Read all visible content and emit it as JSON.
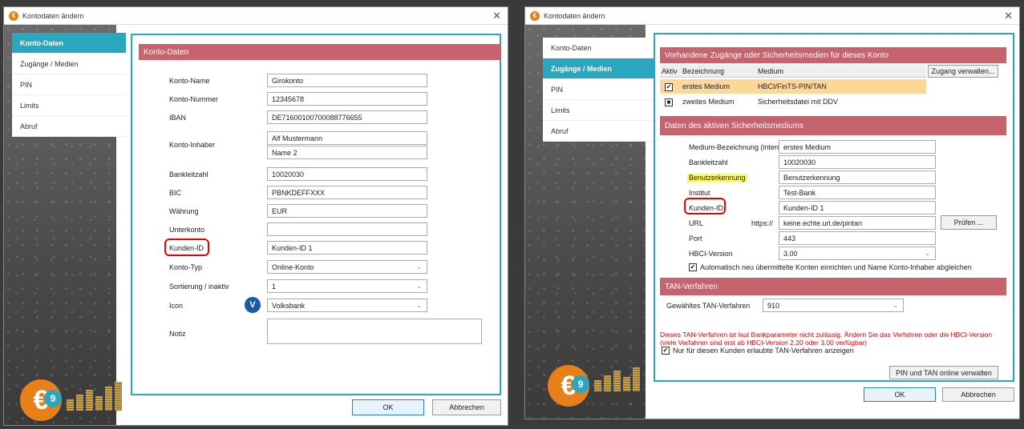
{
  "left": {
    "window_title": "Kontodaten ändern",
    "close": "✕",
    "nav": [
      "Konto-Daten",
      "Zugänge / Medien",
      "PIN",
      "Limits",
      "Abruf"
    ],
    "section": "Konto-Daten",
    "fields": {
      "konto_name": {
        "label": "Konto-Name",
        "value": "Girokonto"
      },
      "konto_nummer": {
        "label": "Konto-Nummer",
        "value": "12345678"
      },
      "iban": {
        "label": "IBAN",
        "value": "DE71600100700088776655"
      },
      "inhaber": {
        "label": "Konto-Inhaber",
        "value1": "Alf Mustermann",
        "value2": "Name 2"
      },
      "blz": {
        "label": "Bankleitzahl",
        "value": "10020030"
      },
      "bic": {
        "label": "BIC",
        "value": "PBNKDEFFXXX"
      },
      "waehrung": {
        "label": "Währung",
        "value": "EUR"
      },
      "unterkonto": {
        "label": "Unterkonto",
        "value": ""
      },
      "kunden_id": {
        "label": "Kunden-ID",
        "value": "Kunden-ID 1"
      },
      "konto_typ": {
        "label": "Konto-Typ",
        "value": "Online-Konto"
      },
      "sortierung": {
        "label": "Sortierung / inaktiv",
        "value": "1"
      },
      "icon": {
        "label": "Icon",
        "value": "Volksbank"
      },
      "notiz": {
        "label": "Notiz"
      }
    },
    "ok": "OK",
    "cancel": "Abbrechen"
  },
  "right": {
    "window_title": "Kontodaten ändern",
    "close": "✕",
    "nav": [
      "Konto-Daten",
      "Zugänge / Medien",
      "PIN",
      "Limits",
      "Abruf"
    ],
    "section1": "Vorhandene Zugänge oder Sicherheitsmedien für dieses Konto",
    "table_headers": [
      "Aktiv",
      "Bezeichnung",
      "Medium"
    ],
    "manage_button": "Zugang verwalten...",
    "rows": [
      {
        "active": "✔",
        "name": "erstes Medium",
        "medium": "HBCI/FinTS-PIN/TAN"
      },
      {
        "active": "■",
        "name": "zweites Medium",
        "medium": "Sicherheitsdatei mit DDV"
      }
    ],
    "section2": "Daten des aktiven Sicherheitsmediums",
    "fields": {
      "bezeichnung": {
        "label": "Medium-Bezeichnung (intern)",
        "value": "erstes Medium"
      },
      "blz": {
        "label": "Bankleitzahl",
        "value": "10020030"
      },
      "benutzer": {
        "label": "Benutzerkennung",
        "value": "Benutzerkennung"
      },
      "institut": {
        "label": "Institut",
        "value": "Test-Bank"
      },
      "kunden_id": {
        "label": "Kunden-ID",
        "value": "Kunden-ID 1"
      },
      "url": {
        "label": "URL",
        "prefix": "https://",
        "value": "keine.echte.url.de/pintan"
      },
      "port": {
        "label": "Port",
        "value": "443"
      },
      "hbci": {
        "label": "HBCI-Version",
        "value": "3.00"
      }
    },
    "pruefen": "Prüfen ...",
    "auto_check": "Automatisch neu übermittelte Konten einrichten und Name Konto-Inhaber abgleichen",
    "section3": "TAN-Verfahren",
    "tan_label": "Gewähltes TAN-Verfahren",
    "tan_value": "910",
    "warning": "Dieses TAN-Verfahren ist laut Bankparameter nicht zulässig. Ändern Sie das Verfahren oder die HBCI-Version (viele Verfahren sind erst ab HBCI-Version 2.20 oder 3.00 verfügbar)",
    "only_allowed": "Nur für diesen Kunden erlaubte TAN-Verfahren anzeigen",
    "pin_tan_button": "PIN und TAN online verwalten",
    "ok": "OK",
    "cancel": "Abbrechen"
  }
}
